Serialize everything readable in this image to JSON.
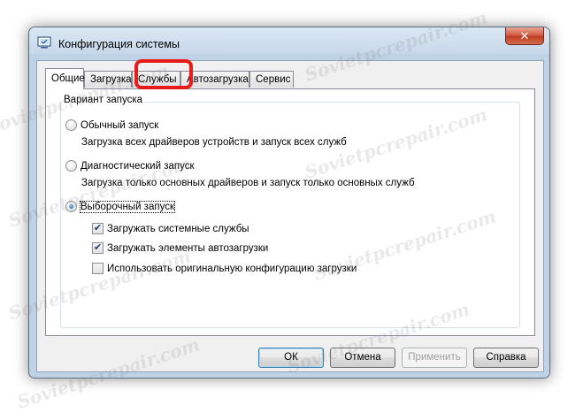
{
  "window": {
    "title": "Конфигурация системы",
    "close_glyph": "✕"
  },
  "tabs": [
    {
      "label": "Общие",
      "active": true
    },
    {
      "label": "Загрузка",
      "active": false
    },
    {
      "label": "Службы",
      "active": false,
      "highlighted": true
    },
    {
      "label": "Автозагрузка",
      "active": false
    },
    {
      "label": "Сервис",
      "active": false
    }
  ],
  "startup": {
    "group_title": "Вариант запуска",
    "normal": {
      "label": "Обычный запуск",
      "description": "Загрузка всех драйверов устройств и запуск всех служб",
      "checked": false
    },
    "diagnostic": {
      "label": "Диагностический запуск",
      "description": "Загрузка только основных драйверов и запуск только основных служб",
      "checked": false
    },
    "selective": {
      "label": "Выборочный запуск",
      "checked": true
    },
    "options": [
      {
        "label": "Загружать системные службы",
        "checked": true
      },
      {
        "label": "Загружать элементы автозагрузки",
        "checked": true
      },
      {
        "label": "Использовать оригинальную конфигурацию загрузки",
        "checked": false
      }
    ]
  },
  "buttons": {
    "ok": "ОК",
    "cancel": "Отмена",
    "apply": "Применить",
    "help": "Справка"
  },
  "watermark": "Sovietpcrepair.com",
  "colors": {
    "highlight": "#e81a1a",
    "title_bar": "#c7d8ea"
  }
}
